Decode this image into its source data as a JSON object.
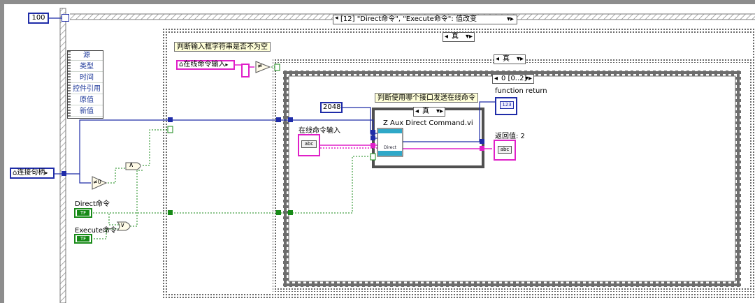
{
  "outer_loop": {
    "count_value": "100"
  },
  "event_case": {
    "selector_label": "[12] \"Direct命令\", \"Execute命令\": 值改变"
  },
  "event_data": {
    "items": [
      "源",
      "类型",
      "时间",
      "控件引用",
      "原值",
      "新值"
    ]
  },
  "case_outer": {
    "selector_value": "真",
    "comment": "判断输入框字符串是否不为空"
  },
  "case_middle": {
    "selector_value": "真"
  },
  "sequence": {
    "frame_label": "0 [0..2]"
  },
  "case_inner": {
    "selector_value": "真",
    "comment": "判断使用哪个接口发送在线命令"
  },
  "controls": {
    "online_cmd_local": "在线命令输入",
    "online_cmd_label": "在线命令输入",
    "connection_handle": "连接句柄",
    "direct_cmd": "Direct命令",
    "execute_cmd": "Execute命令",
    "bool_type": "TF",
    "string_type": "abc",
    "numeric_type": "123"
  },
  "constants": {
    "number_2048": "2048"
  },
  "subvi": {
    "name": "Z Aux Direct Command.vi",
    "icon_text": "Direct"
  },
  "indicators": {
    "function_return": "function return",
    "return_value": "返回值:  2"
  },
  "functions": {
    "not_equal": "≠",
    "not_equal_zero": "≠0",
    "and": "∧",
    "or": "∨"
  },
  "colors": {
    "int_wire": "#1f2ca8",
    "bool_wire": "#178a17",
    "string_wire": "#e020c8",
    "structure_border": "#404040"
  }
}
